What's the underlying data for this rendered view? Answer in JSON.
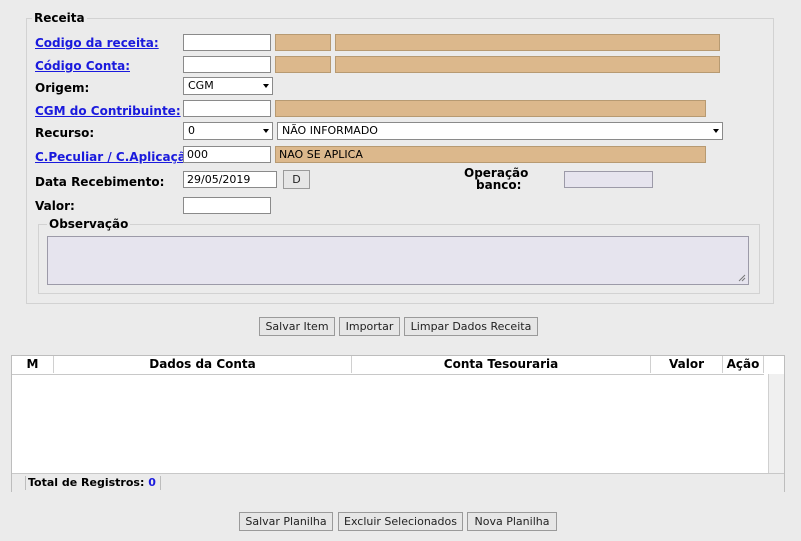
{
  "receita": {
    "legend": "Receita",
    "codigo_receita": {
      "label": "Codigo da receita:",
      "value": "",
      "desc_code": "",
      "desc_text": ""
    },
    "codigo_conta": {
      "label": "Código Conta:",
      "value": "",
      "desc_code": "",
      "desc_text": ""
    },
    "origem": {
      "label": "Origem:",
      "selected": "CGM"
    },
    "cgm_contribuinte": {
      "label": "CGM do Contribuinte:",
      "value": "",
      "desc_text": ""
    },
    "recurso": {
      "label": "Recurso:",
      "code_selected": "0",
      "name_selected": "NÃO INFORMADO"
    },
    "c_peculiar": {
      "label": "C.Peculiar / C.Aplicação :",
      "value": "000",
      "desc_text": "NAO SE APLICA"
    },
    "data_recebimento": {
      "label": "Data Recebimento:",
      "value": "29/05/2019",
      "date_button": "D"
    },
    "operacao_banco": {
      "label_line1": "Operação",
      "label_line2": "banco:",
      "value": ""
    },
    "valor": {
      "label": "Valor:",
      "value": ""
    },
    "observacao": {
      "legend": "Observação",
      "value": ""
    }
  },
  "actions": {
    "salvar_item": "Salvar Item",
    "importar": "Importar",
    "limpar": "Limpar Dados Receita"
  },
  "grid": {
    "headers": {
      "m": "M",
      "dados_conta": "Dados da Conta",
      "conta_tesouraria": "Conta Tesouraria",
      "valor": "Valor",
      "acao": "Ação"
    },
    "rows": [],
    "total_label": "Total de Registros:",
    "total_value": "0"
  },
  "footer": {
    "salvar_planilha": "Salvar Planilha",
    "excluir_selecionados": "Excluir Selecionados",
    "nova_planilha": "Nova Planilha"
  },
  "colors": {
    "readonly_fill": "#dcb88c",
    "link": "#1a1add",
    "total_value": "#1a1add"
  }
}
